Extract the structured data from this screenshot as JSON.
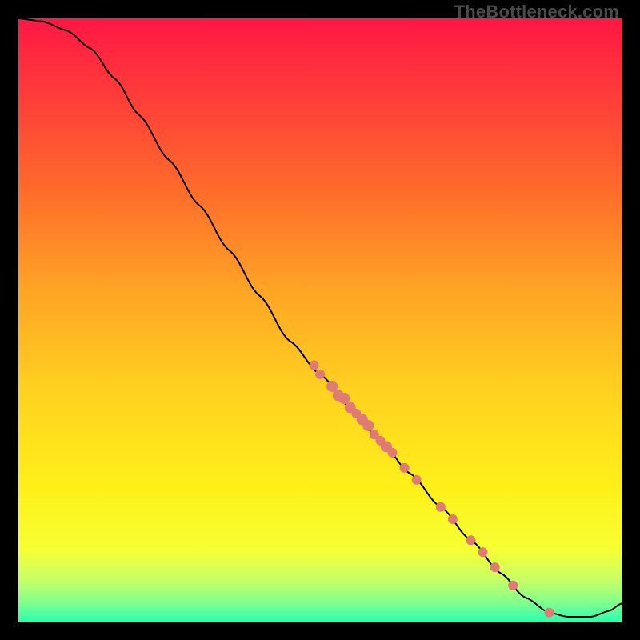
{
  "watermark": "TheBottleneck.com",
  "gradient_stops": [
    {
      "offset": 0.0,
      "color": "#ff1744"
    },
    {
      "offset": 0.12,
      "color": "#ff3a3a"
    },
    {
      "offset": 0.28,
      "color": "#ff6a2b"
    },
    {
      "offset": 0.45,
      "color": "#ffa425"
    },
    {
      "offset": 0.62,
      "color": "#ffd21f"
    },
    {
      "offset": 0.78,
      "color": "#fff01a"
    },
    {
      "offset": 0.88,
      "color": "#f6ff33"
    },
    {
      "offset": 0.93,
      "color": "#c8ff66"
    },
    {
      "offset": 0.97,
      "color": "#7dff8f"
    },
    {
      "offset": 1.0,
      "color": "#2bffb0"
    }
  ],
  "chart_data": {
    "type": "line",
    "title": "",
    "xlabel": "",
    "ylabel": "",
    "xlim": [
      0,
      100
    ],
    "ylim": [
      0,
      100
    ],
    "grid": false,
    "line_points": [
      {
        "x": 0,
        "y": 100
      },
      {
        "x": 4,
        "y": 99.5
      },
      {
        "x": 8,
        "y": 98
      },
      {
        "x": 12,
        "y": 95
      },
      {
        "x": 16,
        "y": 90
      },
      {
        "x": 20,
        "y": 84
      },
      {
        "x": 25,
        "y": 76.5
      },
      {
        "x": 30,
        "y": 69
      },
      {
        "x": 35,
        "y": 61.5
      },
      {
        "x": 40,
        "y": 54
      },
      {
        "x": 45,
        "y": 46.5
      },
      {
        "x": 50,
        "y": 41
      },
      {
        "x": 55,
        "y": 35.5
      },
      {
        "x": 60,
        "y": 30
      },
      {
        "x": 65,
        "y": 24.5
      },
      {
        "x": 70,
        "y": 19
      },
      {
        "x": 75,
        "y": 13.5
      },
      {
        "x": 80,
        "y": 8
      },
      {
        "x": 84,
        "y": 4
      },
      {
        "x": 88,
        "y": 1.5
      },
      {
        "x": 91,
        "y": 0.8
      },
      {
        "x": 95,
        "y": 0.8
      },
      {
        "x": 98,
        "y": 1.8
      },
      {
        "x": 100,
        "y": 3
      }
    ],
    "scatter_points": [
      {
        "x": 49,
        "y": 42.5,
        "r": 6
      },
      {
        "x": 50,
        "y": 41.0,
        "r": 6
      },
      {
        "x": 52,
        "y": 39.0,
        "r": 7
      },
      {
        "x": 53,
        "y": 37.5,
        "r": 7
      },
      {
        "x": 54,
        "y": 37.0,
        "r": 7
      },
      {
        "x": 55,
        "y": 35.5,
        "r": 7
      },
      {
        "x": 56,
        "y": 34.5,
        "r": 6
      },
      {
        "x": 57,
        "y": 33.5,
        "r": 7
      },
      {
        "x": 58,
        "y": 32.5,
        "r": 7
      },
      {
        "x": 59,
        "y": 31.0,
        "r": 6
      },
      {
        "x": 60,
        "y": 30.0,
        "r": 6
      },
      {
        "x": 61,
        "y": 29.0,
        "r": 7
      },
      {
        "x": 62,
        "y": 28.0,
        "r": 6
      },
      {
        "x": 64,
        "y": 25.5,
        "r": 6
      },
      {
        "x": 66,
        "y": 23.5,
        "r": 6
      },
      {
        "x": 70,
        "y": 19.0,
        "r": 6
      },
      {
        "x": 72,
        "y": 17.0,
        "r": 6
      },
      {
        "x": 75,
        "y": 13.5,
        "r": 6
      },
      {
        "x": 77,
        "y": 11.5,
        "r": 6
      },
      {
        "x": 79,
        "y": 9.0,
        "r": 6
      },
      {
        "x": 82,
        "y": 6.0,
        "r": 6
      },
      {
        "x": 88,
        "y": 1.5,
        "r": 6
      }
    ],
    "marker_color": "#e07a74",
    "line_color": "#000000"
  }
}
